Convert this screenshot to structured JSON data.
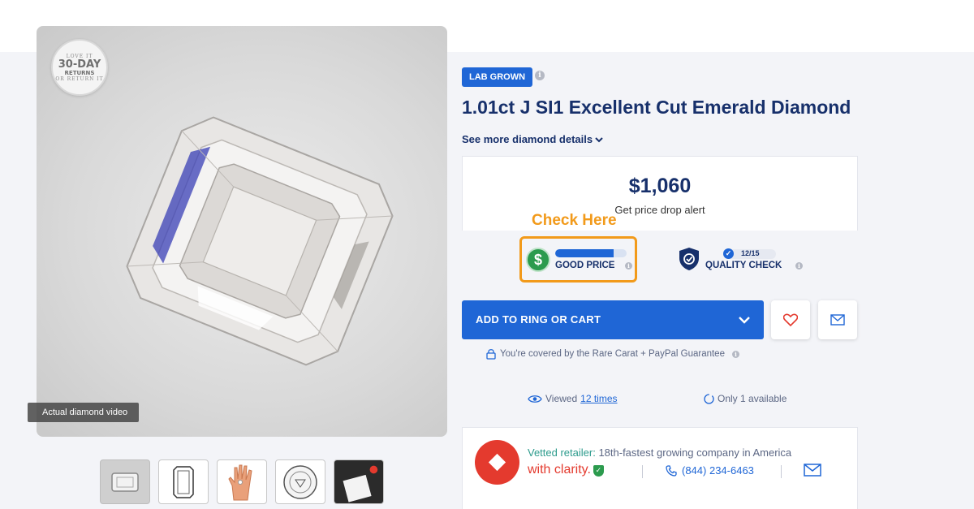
{
  "media": {
    "returns_badge": {
      "top": "LOVE IT",
      "big": "30-DAY",
      "mid": "RETURNS",
      "bottom": "OR RETURN IT"
    },
    "video_label": "Actual diamond video",
    "thumbnails": [
      "emerald-diamond-thumb",
      "diamond-outline-thumb",
      "hand-ring-thumb",
      "certificate-seal-thumb",
      "retailer-box-thumb"
    ]
  },
  "product": {
    "badge": "LAB GROWN",
    "title": "1.01ct J SI1 Excellent Cut Emerald Diamond",
    "details_link": "See more diamond details",
    "price": "$1,060",
    "price_alert": "Get price drop alert"
  },
  "annotation": {
    "label": "Check Here",
    "color": "#f29a1a"
  },
  "indicators": {
    "price": {
      "label": "GOOD PRICE",
      "level": 0.82
    },
    "quality": {
      "label": "QUALITY CHECK",
      "score": "12",
      "max": "/15",
      "score_text": "12/15"
    }
  },
  "actions": {
    "cart_label": "ADD TO RING OR CART",
    "guarantee": "You're covered by the Rare Carat + PayPal Guarantee"
  },
  "stats": {
    "viewed_prefix": "Viewed",
    "viewed_link": "12 times",
    "availability": "Only 1 available"
  },
  "retailer": {
    "vetted_label": "Vetted retailer:",
    "vetted_text": " 18th-fastest growing company in America",
    "name": "with clarity.",
    "phone": "(844) 234-6463"
  },
  "colors": {
    "primary": "#1f66d6",
    "navy": "#17306b",
    "accent_orange": "#f29a1a",
    "green": "#2c9b4e",
    "retailer_red": "#e43a2e"
  }
}
